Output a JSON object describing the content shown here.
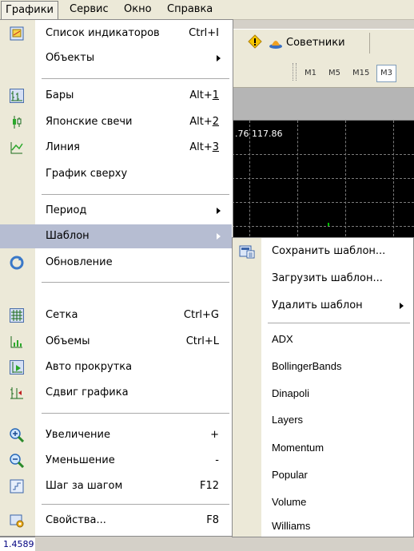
{
  "menubar": {
    "items": [
      "Графики",
      "Сервис",
      "Окно",
      "Справка"
    ]
  },
  "toolbar": {
    "experts_label": "Советники",
    "periods": [
      "M1",
      "M5",
      "M15",
      "M3"
    ]
  },
  "chart": {
    "prices": ".76 117.86",
    "bottom_price": "1.4589"
  },
  "menu": {
    "indicators_list": {
      "label": "Список индикаторов",
      "shortcut": "Ctrl+I"
    },
    "objects": {
      "label": "Объекты"
    },
    "bars": {
      "label": "Бары",
      "shortcut_prefix": "Alt+",
      "shortcut_key": "1"
    },
    "candles": {
      "label": "Японские свечи",
      "shortcut_prefix": "Alt+",
      "shortcut_key": "2"
    },
    "line": {
      "label": "Линия",
      "shortcut_prefix": "Alt+",
      "shortcut_key": "3"
    },
    "chart_on_top": {
      "label": "График сверху"
    },
    "period": {
      "label": "Период"
    },
    "template": {
      "label": "Шаблон"
    },
    "refresh": {
      "label": "Обновление"
    },
    "grid": {
      "label": "Сетка",
      "shortcut": "Ctrl+G"
    },
    "volumes": {
      "label": "Объемы",
      "shortcut": "Ctrl+L"
    },
    "autoscroll": {
      "label": "Авто прокрутка"
    },
    "chart_shift": {
      "label": "Сдвиг графика"
    },
    "zoom_in": {
      "label": "Увеличение",
      "shortcut": "+"
    },
    "zoom_out": {
      "label": "Уменьшение",
      "shortcut": "-"
    },
    "step": {
      "label": "Шаг за шагом",
      "shortcut": "F12"
    },
    "properties": {
      "label": "Свойства...",
      "shortcut": "F8"
    }
  },
  "submenu": {
    "save": "Сохранить шаблон...",
    "load": "Загрузить шаблон...",
    "delete": "Удалить шаблон",
    "templates": [
      "ADX",
      "BollingerBands",
      "Dinapoli",
      "Layers",
      "Momentum",
      "Popular",
      "Volume",
      "Williams"
    ]
  }
}
